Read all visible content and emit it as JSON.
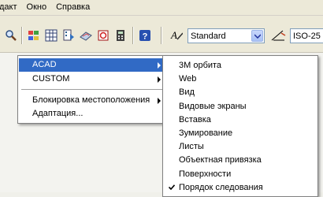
{
  "menubar": {
    "items": [
      "дакт",
      "Окно",
      "Справка"
    ]
  },
  "toolbar": {
    "text_style_value": "Standard",
    "dim_style_value": "ISO-25"
  },
  "context_menu": {
    "items": [
      {
        "label": "ACAD",
        "submenu": true,
        "highlighted": true
      },
      {
        "label": "CUSTOM",
        "submenu": true
      }
    ],
    "items2": [
      {
        "label": "Блокировка местоположения",
        "submenu": true
      },
      {
        "label": "Адаптация..."
      }
    ]
  },
  "submenu": {
    "items": [
      "3М орбита",
      "Web",
      "Вид",
      "Видовые экраны",
      "Вставка",
      "Зумирование",
      "Листы",
      "Объектная привязка",
      "Поверхности",
      "Порядок следования"
    ],
    "checked_item": "Порядок следования"
  },
  "colors": {
    "highlight": "#316ac5",
    "menubar": "#ece9d8"
  }
}
